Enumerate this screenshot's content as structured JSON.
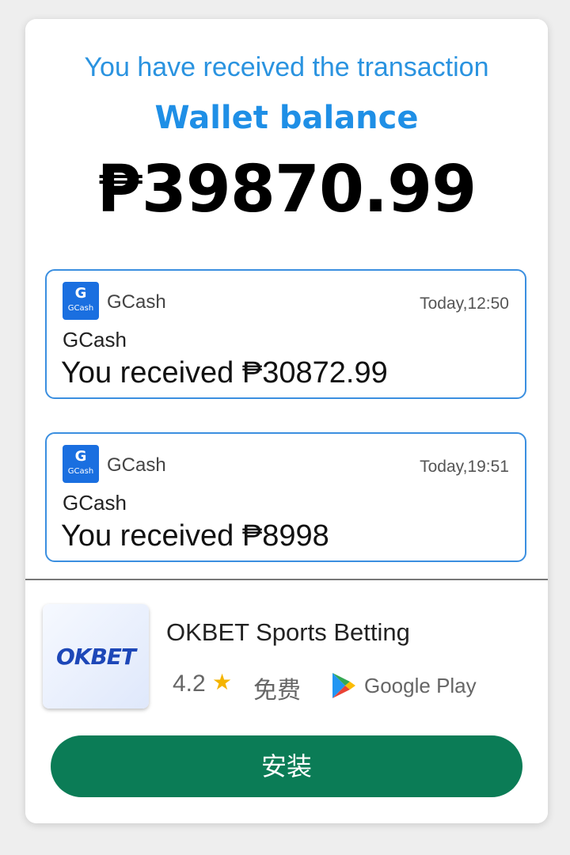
{
  "header": {
    "received_text": "You have received the transaction",
    "wallet_label": "Wallet balance",
    "balance": "₱39870.99"
  },
  "notifications": [
    {
      "icon": "gcash-icon",
      "app": "GCash",
      "time": "Today,12:50",
      "sender": "GCash",
      "message": "You received ₱30872.99"
    },
    {
      "icon": "gcash-icon",
      "app": "GCash",
      "time": "Today,19:51",
      "sender": "GCash",
      "message": "You received ₱8998"
    }
  ],
  "gcash_icon_text": {
    "g": "G",
    "label": "GCash"
  },
  "ad": {
    "logo_text": "OKBET",
    "title": "OKBET Sports Betting",
    "rating": "4.2",
    "price": "免费",
    "store": "Google Play",
    "install_label": "安装"
  },
  "colors": {
    "accent_blue": "#1f8fe6",
    "install_green": "#0b7c56",
    "star": "#f4b400"
  }
}
